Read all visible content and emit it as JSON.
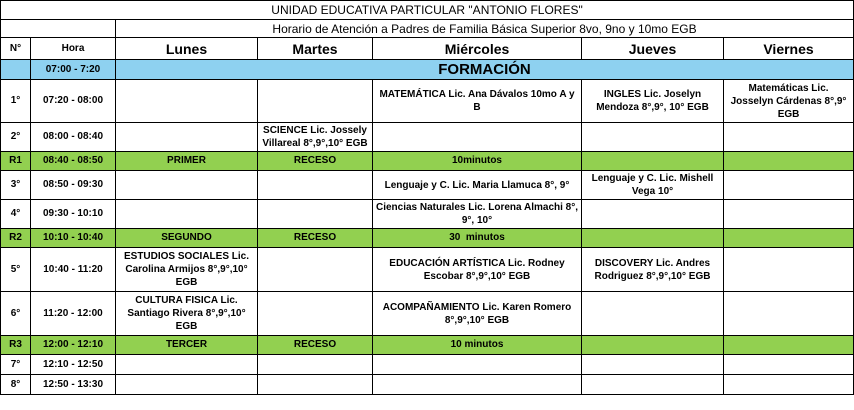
{
  "header": {
    "school": "UNIDAD EDUCATIVA PARTICULAR \"ANTONIO FLORES\"",
    "subtitle": "Horario de Atención a Padres de Familia Básica Superior 8vo, 9no y 10mo EGB"
  },
  "columns": {
    "num": "N°",
    "hora": "Hora",
    "lunes": "Lunes",
    "martes": "Martes",
    "miercoles": "Miércoles",
    "jueves": "Jueves",
    "viernes": "Viernes"
  },
  "formacion": {
    "time": "07:00 - 7:20",
    "label": "FORMACIÓN"
  },
  "rows": [
    {
      "n": "1°",
      "time": "07:20 - 08:00",
      "lunes": "",
      "martes": "",
      "miercoles": "MATEMÁTICA Lic. Ana Dávalos 10mo A y B",
      "jueves": "INGLES Lic. Joselyn Mendoza 8°,9°, 10° EGB",
      "viernes": "Matemáticas Lic. Josselyn Cárdenas 8°,9° EGB"
    },
    {
      "n": "2°",
      "time": "08:00 - 08:40",
      "lunes": "",
      "martes": "SCIENCE Lic. Jossely Villareal 8°,9°,10° EGB",
      "miercoles": "",
      "jueves": "",
      "viernes": ""
    },
    {
      "n": "R1",
      "time": "08:40 - 08:50",
      "lunes": "PRIMER",
      "martes": "RECESO",
      "miercoles": "10minutos",
      "jueves": "",
      "viernes": ""
    },
    {
      "n": "3°",
      "time": "08:50 - 09:30",
      "lunes": "",
      "martes": "",
      "miercoles": "Lenguaje y C. Lic. Maria Llamuca 8°, 9°",
      "jueves": "Lenguaje y C. Lic. Mishell Vega 10°",
      "viernes": ""
    },
    {
      "n": "4°",
      "time": "09:30 - 10:10",
      "lunes": "",
      "martes": "",
      "miercoles": "Ciencias Naturales Lic. Lorena Almachi 8°, 9°, 10°",
      "jueves": "",
      "viernes": ""
    },
    {
      "n": "R2",
      "time": "10:10 - 10:40",
      "lunes": "SEGUNDO",
      "martes": "RECESO",
      "miercoles": "30  minutos",
      "jueves": "",
      "viernes": ""
    },
    {
      "n": "5°",
      "time": "10:40 - 11:20",
      "lunes": "ESTUDIOS SOCIALES Lic. Carolina Armijos 8°,9°,10° EGB",
      "martes": "",
      "miercoles": "EDUCACIÓN ARTÍSTICA  Lic. Rodney Escobar 8°,9°,10° EGB",
      "jueves": "DISCOVERY Lic. Andres Rodriguez 8°,9°,10° EGB",
      "viernes": ""
    },
    {
      "n": "6°",
      "time": "11:20 - 12:00",
      "lunes": "CULTURA FISICA Lic. Santiago Rivera 8°,9°,10° EGB",
      "martes": "",
      "miercoles": "ACOMPAÑAMIENTO Lic. Karen Romero 8°,9°,10° EGB",
      "jueves": "",
      "viernes": ""
    },
    {
      "n": "R3",
      "time": "12:00 - 12:10",
      "lunes": "TERCER",
      "martes": "RECESO",
      "miercoles": "10 minutos",
      "jueves": "",
      "viernes": ""
    },
    {
      "n": "7°",
      "time": "12:10 - 12:50",
      "lunes": "",
      "martes": "",
      "miercoles": "",
      "jueves": "",
      "viernes": ""
    },
    {
      "n": "8°",
      "time": "12:50 - 13:30",
      "lunes": "",
      "martes": "",
      "miercoles": "",
      "jueves": "",
      "viernes": ""
    }
  ]
}
